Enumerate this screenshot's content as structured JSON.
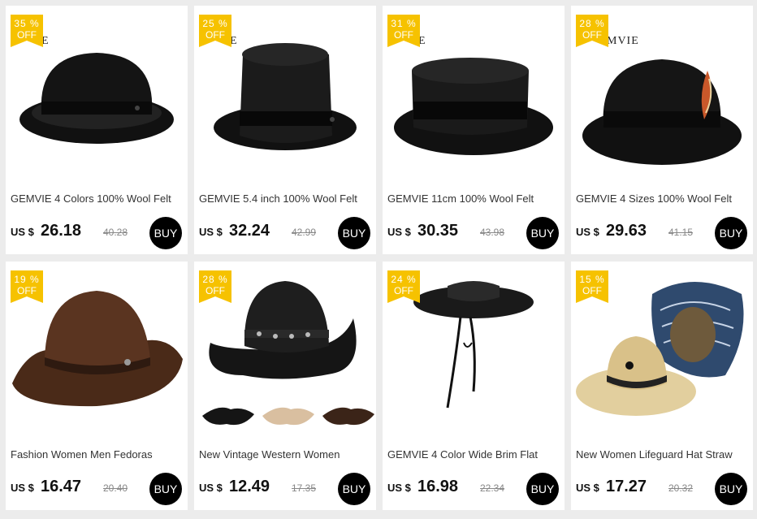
{
  "products": [
    {
      "discount": "35 %",
      "off": "OFF",
      "brand": "E",
      "title": "GEMVIE 4 Colors 100% Wool Felt",
      "currency": "US $",
      "price": "26.18",
      "old_price": "40.28",
      "buy": "BUY"
    },
    {
      "discount": "25 %",
      "off": "OFF",
      "brand": "E",
      "title": "GEMVIE 5.4 inch 100% Wool Felt",
      "currency": "US $",
      "price": "32.24",
      "old_price": "42.99",
      "buy": "BUY"
    },
    {
      "discount": "31 %",
      "off": "OFF",
      "brand": "E",
      "title": "GEMVIE 11cm 100% Wool Felt",
      "currency": "US $",
      "price": "30.35",
      "old_price": "43.98",
      "buy": "BUY"
    },
    {
      "discount": "28 %",
      "off": "OFF",
      "brand": "MVIE",
      "title": "GEMVIE 4 Sizes 100% Wool Felt",
      "currency": "US $",
      "price": "29.63",
      "old_price": "41.15",
      "buy": "BUY"
    },
    {
      "discount": "19 %",
      "off": "OFF",
      "brand": "",
      "title": "Fashion Women Men Fedoras",
      "currency": "US $",
      "price": "16.47",
      "old_price": "20.40",
      "buy": "BUY"
    },
    {
      "discount": "28 %",
      "off": "OFF",
      "brand": "",
      "title": "New Vintage Western Women",
      "currency": "US $",
      "price": "12.49",
      "old_price": "17.35",
      "buy": "BUY"
    },
    {
      "discount": "24 %",
      "off": "OFF",
      "brand": "",
      "title": "GEMVIE 4 Color Wide Brim Flat",
      "currency": "US $",
      "price": "16.98",
      "old_price": "22.34",
      "buy": "BUY"
    },
    {
      "discount": "15 %",
      "off": "OFF",
      "brand": "",
      "title": "New Women Lifeguard Hat Straw",
      "currency": "US $",
      "price": "17.27",
      "old_price": "20.32",
      "buy": "BUY"
    }
  ],
  "colors": {
    "badge": "#f6c200",
    "buy_button": "#000000",
    "card": "#ffffff",
    "page": "#ececec"
  },
  "images": [
    "bowler-hat-image",
    "top-hat-image",
    "flat-top-hat-image",
    "bowler-hat-with-feather-image",
    "brown-fedora-image",
    "cowboy-hat-set-image",
    "wide-brim-straw-hat-image",
    "lifeguard-straw-hat-image"
  ]
}
